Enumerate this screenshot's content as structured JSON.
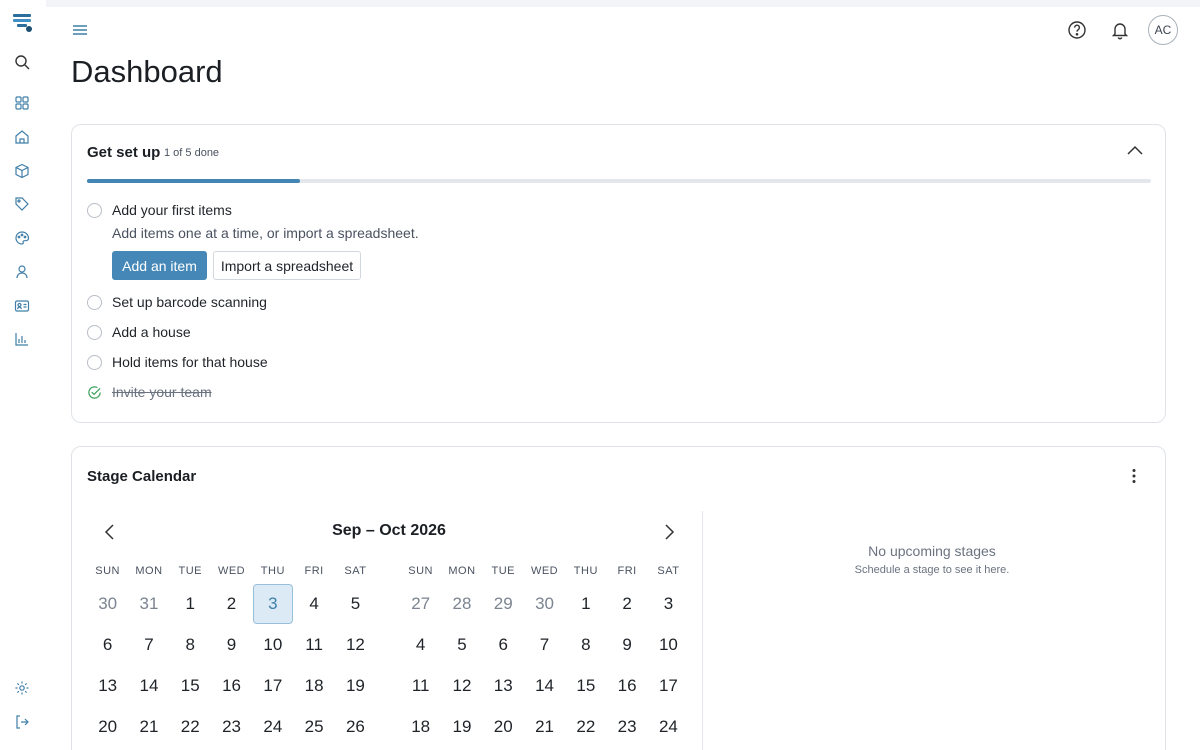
{
  "header": {
    "title": "Dashboard",
    "avatar_initials": "AC"
  },
  "sidebar": {
    "icons": [
      "search-icon",
      "grid-icon",
      "home-icon",
      "box-icon",
      "tag-icon",
      "palette-icon",
      "user-icon",
      "id-card-icon",
      "chart-icon",
      "settings-icon",
      "logout-icon"
    ]
  },
  "setup": {
    "title": "Get set up",
    "count": "1 of 5 done",
    "progress": 0.2,
    "tasks": [
      {
        "label": "Add your first items",
        "done": false
      },
      {
        "label": "Set up barcode scanning",
        "done": false
      },
      {
        "label": "Add a house",
        "done": false
      },
      {
        "label": "Hold items for that house",
        "done": false
      },
      {
        "label": "Invite your team",
        "done": true
      }
    ],
    "first_task_description": "Add items one at a time, or import a spreadsheet.",
    "primary_button": "Add an item",
    "secondary_button": "Import a spreadsheet"
  },
  "calendar": {
    "title": "Stage Calendar",
    "range_label": "Sep – Oct 2026",
    "weekdays": [
      "SUN",
      "MON",
      "TUE",
      "WED",
      "THU",
      "FRI",
      "SAT"
    ],
    "months": [
      {
        "rows": [
          [
            {
              "d": "30",
              "m": true
            },
            {
              "d": "31",
              "m": true
            },
            {
              "d": "1"
            },
            {
              "d": "2"
            },
            {
              "d": "3",
              "today": true
            },
            {
              "d": "4"
            },
            {
              "d": "5"
            }
          ],
          [
            {
              "d": "6"
            },
            {
              "d": "7"
            },
            {
              "d": "8"
            },
            {
              "d": "9"
            },
            {
              "d": "10"
            },
            {
              "d": "11"
            },
            {
              "d": "12"
            }
          ],
          [
            {
              "d": "13"
            },
            {
              "d": "14"
            },
            {
              "d": "15"
            },
            {
              "d": "16"
            },
            {
              "d": "17"
            },
            {
              "d": "18"
            },
            {
              "d": "19"
            }
          ],
          [
            {
              "d": "20"
            },
            {
              "d": "21"
            },
            {
              "d": "22"
            },
            {
              "d": "23"
            },
            {
              "d": "24"
            },
            {
              "d": "25"
            },
            {
              "d": "26"
            }
          ]
        ]
      },
      {
        "rows": [
          [
            {
              "d": "27",
              "m": true
            },
            {
              "d": "28",
              "m": true
            },
            {
              "d": "29",
              "m": true
            },
            {
              "d": "30",
              "m": true
            },
            {
              "d": "1"
            },
            {
              "d": "2"
            },
            {
              "d": "3"
            }
          ],
          [
            {
              "d": "4"
            },
            {
              "d": "5"
            },
            {
              "d": "6"
            },
            {
              "d": "7"
            },
            {
              "d": "8"
            },
            {
              "d": "9"
            },
            {
              "d": "10"
            }
          ],
          [
            {
              "d": "11"
            },
            {
              "d": "12"
            },
            {
              "d": "13"
            },
            {
              "d": "14"
            },
            {
              "d": "15"
            },
            {
              "d": "16"
            },
            {
              "d": "17"
            }
          ],
          [
            {
              "d": "18"
            },
            {
              "d": "19"
            },
            {
              "d": "20"
            },
            {
              "d": "21"
            },
            {
              "d": "22"
            },
            {
              "d": "23"
            },
            {
              "d": "24"
            }
          ]
        ]
      }
    ],
    "empty_title": "No upcoming stages",
    "empty_subtitle": "Schedule a stage to see it here."
  },
  "colors": {
    "accent": "#4588b8",
    "today_bg": "#dbeaf4",
    "success": "#3aa05a"
  }
}
